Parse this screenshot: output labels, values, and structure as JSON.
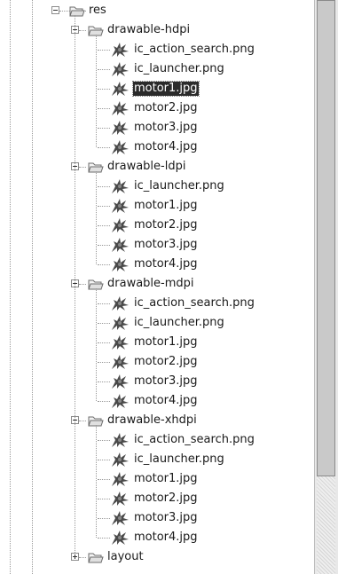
{
  "tree": {
    "res": {
      "label": "res"
    },
    "folders": [
      {
        "label": "drawable-hdpi",
        "expanded": true,
        "files": [
          "ic_action_search.png",
          "ic_launcher.png",
          "motor1.jpg",
          "motor2.jpg",
          "motor3.jpg",
          "motor4.jpg"
        ],
        "selected_index": 2
      },
      {
        "label": "drawable-ldpi",
        "expanded": true,
        "files": [
          "ic_launcher.png",
          "motor1.jpg",
          "motor2.jpg",
          "motor3.jpg",
          "motor4.jpg"
        ],
        "selected_index": -1
      },
      {
        "label": "drawable-mdpi",
        "expanded": true,
        "files": [
          "ic_action_search.png",
          "ic_launcher.png",
          "motor1.jpg",
          "motor2.jpg",
          "motor3.jpg",
          "motor4.jpg"
        ],
        "selected_index": -1
      },
      {
        "label": "drawable-xhdpi",
        "expanded": true,
        "files": [
          "ic_action_search.png",
          "ic_launcher.png",
          "motor1.jpg",
          "motor2.jpg",
          "motor3.jpg",
          "motor4.jpg"
        ],
        "selected_index": -1
      },
      {
        "label": "layout",
        "expanded": false,
        "files": [],
        "selected_index": -1
      }
    ]
  },
  "icons": {
    "folder": "folder-icon",
    "file": "image-file-icon",
    "res_folder": "source-folder-icon"
  },
  "colors": {
    "selection_bg": "#2b2b2b",
    "selection_fg": "#ffffff",
    "tree_line": "#9a9a9a"
  },
  "scrollbar": {
    "position_fraction": 0.83
  }
}
